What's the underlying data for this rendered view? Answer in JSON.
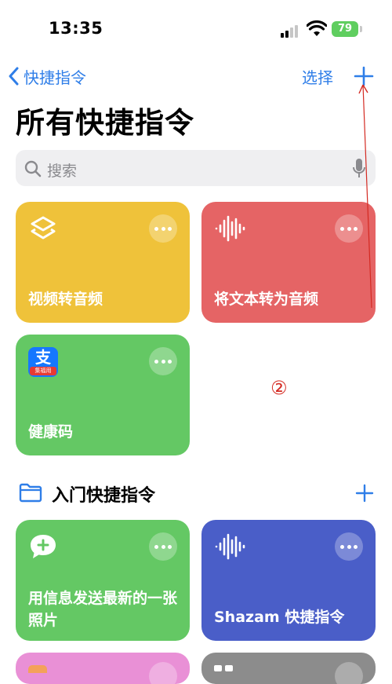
{
  "status_bar": {
    "time": "13:35",
    "battery": "79"
  },
  "nav": {
    "back_label": "快捷指令",
    "select_label": "选择"
  },
  "page_title": "所有快捷指令",
  "search": {
    "placeholder": "搜索"
  },
  "shortcuts": [
    {
      "label": "视频转音频",
      "color": "#efc23a",
      "icon": "layers-icon"
    },
    {
      "label": "将文本转为音频",
      "color": "#e56465",
      "icon": "waveform-icon"
    },
    {
      "label": "健康码",
      "color": "#64c864",
      "icon": "alipay-icon",
      "icon_text": "支",
      "icon_sub": "集福用"
    }
  ],
  "annotation": {
    "number": "②",
    "color": "#d42a22"
  },
  "starter_section": {
    "title": "入门快捷指令"
  },
  "starter_shortcuts": [
    {
      "label": "用信息发送最新的一张照片",
      "color": "#64c864",
      "icon": "message-plus-icon"
    },
    {
      "label": "Shazam 快捷指令",
      "color": "#4a5ec8",
      "icon": "waveform-icon"
    }
  ],
  "colors": {
    "accent": "#2f7ee8",
    "pink_card": "#e990d6",
    "gray_card": "#8c8c8c"
  }
}
